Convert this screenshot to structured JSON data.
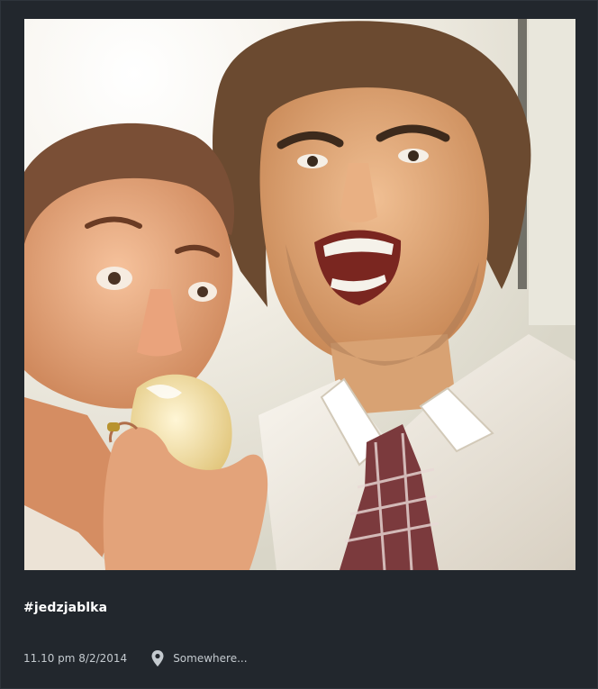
{
  "post": {
    "image_alt": "Selfie of a woman biting an apple next to a man shouting",
    "caption": "#jedzjablka",
    "timestamp": "11.10 pm 8/2/2014",
    "location": "Somewhere..."
  },
  "icons": {
    "location": "location-pin-icon"
  },
  "colors": {
    "background": "#22272d",
    "text": "#ffffff",
    "meta_text": "#c4cacf"
  }
}
